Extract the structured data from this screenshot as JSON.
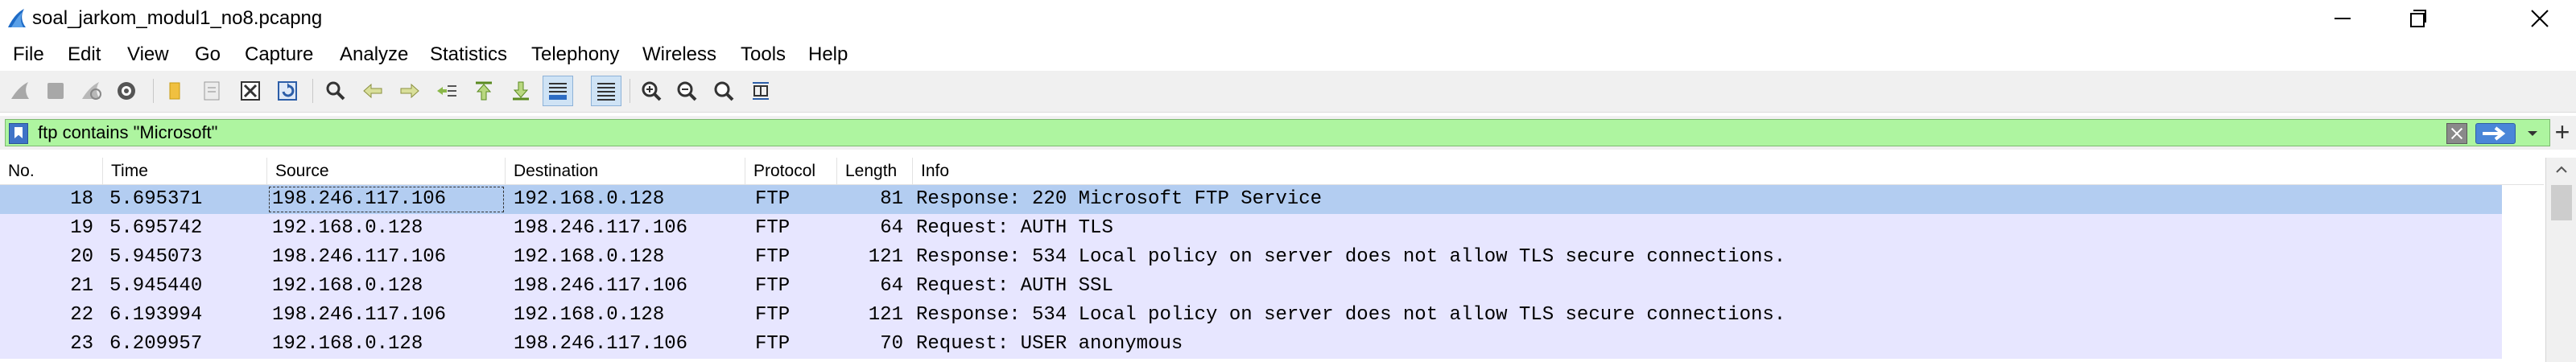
{
  "window": {
    "title": "soal_jarkom_modul1_no8.pcapng"
  },
  "menu": [
    "File",
    "Edit",
    "View",
    "Go",
    "Capture",
    "Analyze",
    "Statistics",
    "Telephony",
    "Wireless",
    "Tools",
    "Help"
  ],
  "toolbar": {
    "icons": [
      "shark-fin-start-icon",
      "stop-capture-icon",
      "restart-capture-icon",
      "capture-options-icon",
      "open-file-icon",
      "save-file-icon",
      "close-file-icon",
      "reload-file-icon",
      "find-packet-icon",
      "go-back-icon",
      "go-forward-icon",
      "go-to-packet-icon",
      "first-packet-icon",
      "last-packet-icon",
      "auto-scroll-icon",
      "colorize-icon",
      "zoom-in-icon",
      "zoom-out-icon",
      "normal-size-icon",
      "resize-columns-icon"
    ]
  },
  "filter": {
    "value": "ftp contains \"Microsoft\"",
    "background_color": "#aef5a0"
  },
  "packet_list": {
    "columns": [
      "No.",
      "Time",
      "Source",
      "Destination",
      "Protocol",
      "Length",
      "Info"
    ],
    "rows": [
      {
        "no": "18",
        "time": "5.695371",
        "source": "198.246.117.106",
        "destination": "192.168.0.128",
        "protocol": "FTP",
        "length": "81",
        "info": "Response: 220 Microsoft FTP Service",
        "selected": true
      },
      {
        "no": "19",
        "time": "5.695742",
        "source": "192.168.0.128",
        "destination": "198.246.117.106",
        "protocol": "FTP",
        "length": "64",
        "info": "Request: AUTH TLS",
        "selected": false
      },
      {
        "no": "20",
        "time": "5.945073",
        "source": "198.246.117.106",
        "destination": "192.168.0.128",
        "protocol": "FTP",
        "length": "121",
        "info": "Response: 534 Local policy on server does not allow TLS secure connections.",
        "selected": false
      },
      {
        "no": "21",
        "time": "5.945440",
        "source": "192.168.0.128",
        "destination": "198.246.117.106",
        "protocol": "FTP",
        "length": "64",
        "info": "Request: AUTH SSL",
        "selected": false
      },
      {
        "no": "22",
        "time": "6.193994",
        "source": "198.246.117.106",
        "destination": "192.168.0.128",
        "protocol": "FTP",
        "length": "121",
        "info": "Response: 534 Local policy on server does not allow TLS secure connections.",
        "selected": false
      },
      {
        "no": "23",
        "time": "6.209957",
        "source": "192.168.0.128",
        "destination": "198.246.117.106",
        "protocol": "FTP",
        "length": "70",
        "info": "Request: USER anonymous",
        "selected": false
      }
    ],
    "row_color": "#e7e6ff",
    "selected_row_color": "#b3cdf1"
  }
}
